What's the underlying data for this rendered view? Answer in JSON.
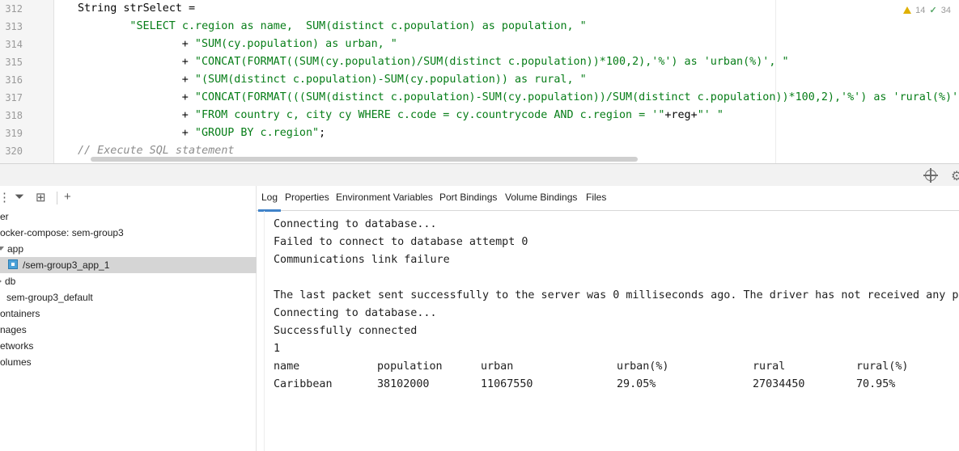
{
  "editor": {
    "line_numbers": [
      "312",
      "313",
      "314",
      "315",
      "316",
      "317",
      "318",
      "319",
      "320"
    ],
    "lines": [
      {
        "indent": 0,
        "parts": [
          {
            "t": "String strSelect =",
            "c": "code"
          }
        ]
      },
      {
        "indent": 8,
        "parts": [
          {
            "t": "\"SELECT c.region as name,  SUM(distinct c.population) as population, \"",
            "c": "str"
          }
        ]
      },
      {
        "indent": 16,
        "parts": [
          {
            "t": "+ ",
            "c": "code"
          },
          {
            "t": "\"SUM(cy.population) as urban, \"",
            "c": "str"
          }
        ]
      },
      {
        "indent": 16,
        "parts": [
          {
            "t": "+ ",
            "c": "code"
          },
          {
            "t": "\"CONCAT(FORMAT((SUM(cy.population)/SUM(distinct c.population))*100,2),'%') as 'urban(%)', \"",
            "c": "str"
          }
        ]
      },
      {
        "indent": 16,
        "parts": [
          {
            "t": "+ ",
            "c": "code"
          },
          {
            "t": "\"(SUM(distinct c.population)-SUM(cy.population)) as rural, \"",
            "c": "str"
          }
        ]
      },
      {
        "indent": 16,
        "parts": [
          {
            "t": "+ ",
            "c": "code"
          },
          {
            "t": "\"CONCAT(FORMAT(((SUM(distinct c.population)-SUM(cy.population))/SUM(distinct c.population))*100,2),'%') as 'rural(%)' \"",
            "c": "str"
          }
        ]
      },
      {
        "indent": 16,
        "parts": [
          {
            "t": "+ ",
            "c": "code"
          },
          {
            "t": "\"FROM country c, city cy WHERE c.code = cy.countrycode AND c.region = '\"",
            "c": "str"
          },
          {
            "t": "+reg+",
            "c": "code"
          },
          {
            "t": "\"' \"",
            "c": "str"
          }
        ]
      },
      {
        "indent": 16,
        "parts": [
          {
            "t": "+ ",
            "c": "code"
          },
          {
            "t": "\"GROUP BY c.region\"",
            "c": "str"
          },
          {
            "t": ";",
            "c": "code"
          }
        ]
      },
      {
        "indent": 0,
        "parts": [
          {
            "t": "// Execute SQL statement",
            "c": "cmt"
          }
        ]
      }
    ],
    "warnings": "14",
    "weak_warnings": "34"
  },
  "tree": {
    "nodes": [
      {
        "label": "er",
        "x": 0,
        "arrow": "none"
      },
      {
        "label": "ocker-compose: sem-group3",
        "x": 0,
        "arrow": "none"
      },
      {
        "label": "app",
        "x": 0,
        "arrow": "down"
      },
      {
        "label": "/sem-group3_app_1",
        "x": 10,
        "arrow": "container",
        "selected": true
      },
      {
        "label": "db",
        "x": 0,
        "arrow": "right"
      },
      {
        "label": "sem-group3_default",
        "x": 8,
        "arrow": "none"
      },
      {
        "label": "ontainers",
        "x": 0,
        "arrow": "none"
      },
      {
        "label": "nages",
        "x": 0,
        "arrow": "none"
      },
      {
        "label": "etworks",
        "x": 0,
        "arrow": "none"
      },
      {
        "label": "olumes",
        "x": 0,
        "arrow": "none"
      }
    ]
  },
  "tabs": [
    "Log",
    "Properties",
    "Environment Variables",
    "Port Bindings",
    "Volume Bindings",
    "Files"
  ],
  "log": {
    "lines": [
      "Connecting to database...",
      "Failed to connect to database attempt 0",
      "Communications link failure",
      "",
      "The last packet sent successfully to the server was 0 milliseconds ago. The driver has not received any pa",
      "Connecting to database...",
      "Successfully connected",
      "1"
    ],
    "table": {
      "headers": [
        "name",
        "population",
        "urban",
        "urban(%)",
        "rural",
        "rural(%)"
      ],
      "rows": [
        [
          "Caribbean",
          "38102000",
          "11067550",
          "29.05%",
          "27034450",
          "70.95%"
        ]
      ]
    }
  }
}
